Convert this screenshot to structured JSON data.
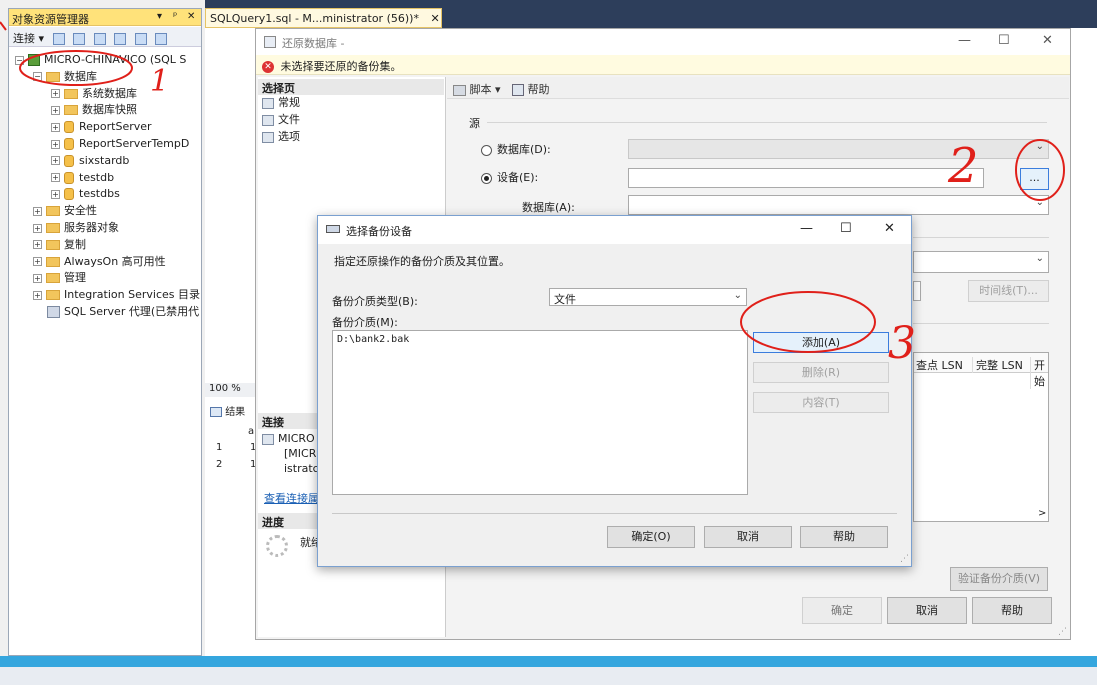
{
  "object_explorer": {
    "title": "对象资源管理器",
    "title_controls": [
      "▾",
      "ᵖ",
      "✕"
    ],
    "connect_label": "连接 ▾",
    "tree": [
      {
        "label": "MICRO-CHINAVICO (SQL S",
        "level": 0,
        "icon": "server-icon",
        "expander": "⊟"
      },
      {
        "label": "数据库",
        "level": 1,
        "icon": "folder-icon",
        "expander": "⊟"
      },
      {
        "label": "系统数据库",
        "level": 2,
        "icon": "folder-icon",
        "expander": "⊞"
      },
      {
        "label": "数据库快照",
        "level": 2,
        "icon": "folder-icon",
        "expander": "⊞"
      },
      {
        "label": "ReportServer",
        "level": 2,
        "icon": "database-icon",
        "expander": "⊞"
      },
      {
        "label": "ReportServerTempD",
        "level": 2,
        "icon": "database-icon",
        "expander": "⊞"
      },
      {
        "label": "sixstardb",
        "level": 2,
        "icon": "database-icon",
        "expander": "⊞"
      },
      {
        "label": "testdb",
        "level": 2,
        "icon": "database-icon",
        "expander": "⊞"
      },
      {
        "label": "testdbs",
        "level": 2,
        "icon": "database-icon",
        "expander": "⊞"
      },
      {
        "label": "安全性",
        "level": 1,
        "icon": "folder-icon",
        "expander": "⊞"
      },
      {
        "label": "服务器对象",
        "level": 1,
        "icon": "folder-icon",
        "expander": "⊞"
      },
      {
        "label": "复制",
        "level": 1,
        "icon": "folder-icon",
        "expander": "⊞"
      },
      {
        "label": "AlwaysOn 高可用性",
        "level": 1,
        "icon": "folder-icon",
        "expander": "⊞"
      },
      {
        "label": "管理",
        "level": 1,
        "icon": "folder-icon",
        "expander": "⊞"
      },
      {
        "label": "Integration Services 目录",
        "level": 1,
        "icon": "folder-icon",
        "expander": "⊞"
      },
      {
        "label": "SQL Server 代理(已禁用代",
        "level": 1,
        "icon": "agent-icon",
        "expander": ""
      }
    ]
  },
  "editor": {
    "tab_label": "SQLQuery1.sql - M...ministrator (56))*",
    "tab_close": "✕",
    "zoom": "100 %",
    "results_tab": "结果",
    "results_rows": [
      "1",
      "2"
    ],
    "results_header": "a",
    "results_cells": [
      "1",
      "1"
    ]
  },
  "restore_dialog": {
    "title": "还原数据库 -",
    "warning": "未选择要还原的备份集。",
    "select_page_header": "选择页",
    "pages": [
      "常规",
      "文件",
      "选项"
    ],
    "connection_header": "连接",
    "connection_lines": [
      "MICRO",
      "[MICR",
      "istratc"
    ],
    "view_connection_link": "查看连接属",
    "progress_header": "进度",
    "progress_status": "就绪",
    "toolbar_script": "脚本",
    "toolbar_help": "帮助",
    "source_label": "源",
    "database_radio": "数据库(D):",
    "device_radio": "设备(E):",
    "device_database_label": "数据库(A):",
    "browse_button": "...",
    "timeline_button": "时间线(T)...",
    "grid_headers": [
      "查点 LSN",
      "完整 LSN",
      "开始"
    ],
    "verify_button": "验证备份介质(V)",
    "ok_button": "确定",
    "cancel_button": "取消",
    "help_button": "帮助",
    "scroll_right": ">"
  },
  "device_dialog": {
    "title": "选择备份设备",
    "description": "指定还原操作的备份介质及其位置。",
    "media_type_label": "备份介质类型(B):",
    "media_type_value": "文件",
    "media_label": "备份介质(M):",
    "media_items": [
      "D:\\bank2.bak"
    ],
    "add_button": "添加(A)",
    "remove_button": "删除(R)",
    "contents_button": "内容(T)",
    "ok_button": "确定(O)",
    "cancel_button": "取消",
    "help_button": "帮助"
  },
  "annotations": [
    "1",
    "2",
    "3"
  ],
  "colors": {
    "annotation": "#e0201a",
    "tab_bar": "#2d3e5b",
    "bottom_stripe": "#35a6de",
    "oe_title": "#ffe27a"
  }
}
